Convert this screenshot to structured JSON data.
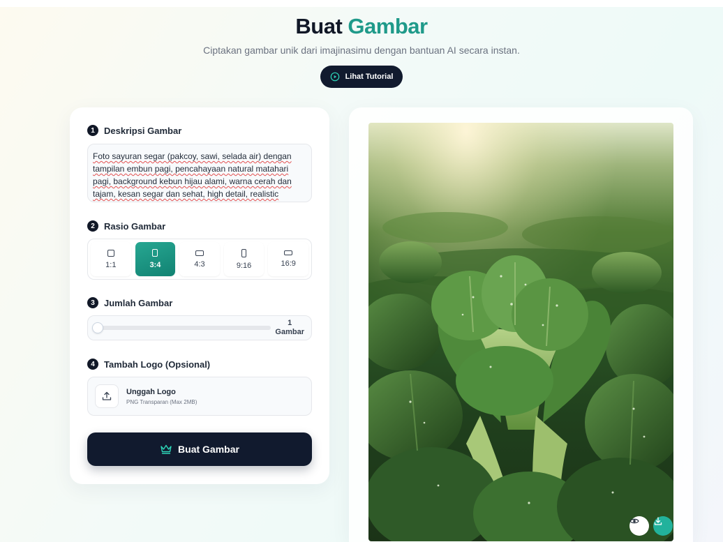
{
  "header": {
    "title_part1": "Buat",
    "title_part2": "Gambar",
    "subtitle": "Ciptakan gambar unik dari imajinasimu dengan bantuan AI secara instan.",
    "tutorial_label": "Lihat Tutorial"
  },
  "sections": {
    "description": {
      "num": "1",
      "label": "Deskripsi Gambar"
    },
    "ratio": {
      "num": "2",
      "label": "Rasio Gambar"
    },
    "count": {
      "num": "3",
      "label": "Jumlah Gambar"
    },
    "logo": {
      "num": "4",
      "label": "Tambah Logo (Opsional)"
    }
  },
  "prompt_text": "Foto sayuran segar (pakcoy, sawi, selada air) dengan tampilan embun pagi, pencahayaan natural matahari pagi, background kebun hijau alami, warna cerah dan tajam, kesan segar dan sehat, high detail, realistic",
  "ratios": [
    {
      "label": "1:1",
      "active": false
    },
    {
      "label": "3:4",
      "active": true
    },
    {
      "label": "4:3",
      "active": false
    },
    {
      "label": "9:16",
      "active": false
    },
    {
      "label": "16:9",
      "active": false
    }
  ],
  "count": {
    "value": "1",
    "unit": "Gambar",
    "fraction": 0
  },
  "upload": {
    "title": "Unggah Logo",
    "hint": "PNG Transparan (Max 2MB)"
  },
  "generate_label": "Buat Gambar",
  "colors": {
    "accent": "#1f9a8a",
    "dark": "#111a2e",
    "download": "#22b29c"
  },
  "icons": {
    "tutorial": "play-circle-icon",
    "upload": "upload-icon",
    "generate": "crown-icon",
    "view": "eye-icon",
    "download": "download-icon"
  }
}
